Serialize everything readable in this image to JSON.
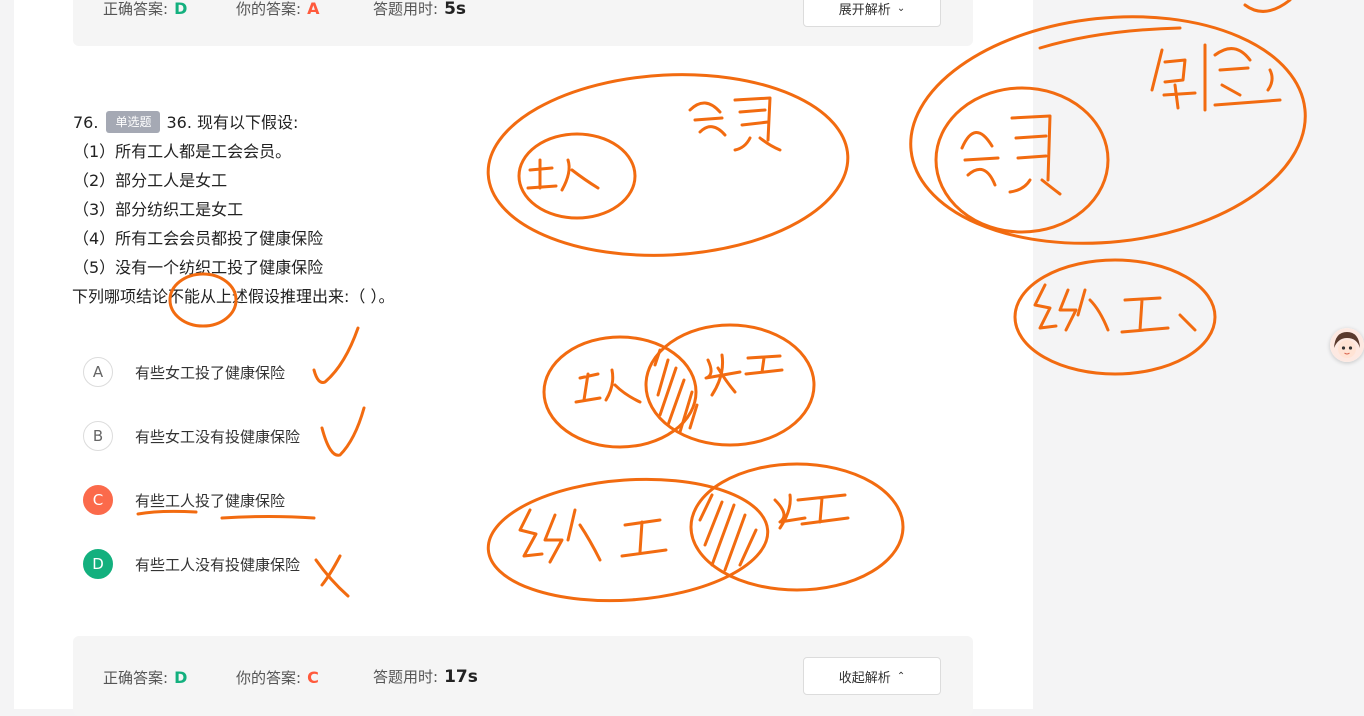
{
  "top_result": {
    "correct_label": "正确答案:",
    "correct_value": "D",
    "yours_label": "你的答案:",
    "yours_value": "A",
    "time_label": "答题用时:",
    "time_value": "5s",
    "toggle_label": "展开解析"
  },
  "question": {
    "number": "76.",
    "type_badge": "单选题",
    "stem_lines": [
      "36. 现有以下假设:",
      "（1）所有工人都是工会会员。",
      "（2）部分工人是女工",
      "（3）部分纺织工是女工",
      "（4）所有工会会员都投了健康保险",
      "（5）没有一个纺织工投了健康保险",
      "下列哪项结论不能从上述假设推理出来:（  ）。"
    ]
  },
  "options": [
    {
      "key": "A",
      "text": "有些女工投了健康保险",
      "state": "neutral"
    },
    {
      "key": "B",
      "text": "有些女工没有投健康保险",
      "state": "neutral"
    },
    {
      "key": "C",
      "text": "有些工人投了健康保险",
      "state": "wrong"
    },
    {
      "key": "D",
      "text": "有些工人没有投健康保险",
      "state": "correct"
    }
  ],
  "bottom_result": {
    "correct_label": "正确答案:",
    "correct_value": "D",
    "yours_label": "你的答案:",
    "yours_value": "C",
    "time_label": "答题用时:",
    "time_value": "17s",
    "toggle_label": "收起解析"
  },
  "colors": {
    "ink": "#f26b10",
    "correct": "#13b07e",
    "wrong": "#ff5a3c",
    "badge": "#a5a9b4"
  }
}
